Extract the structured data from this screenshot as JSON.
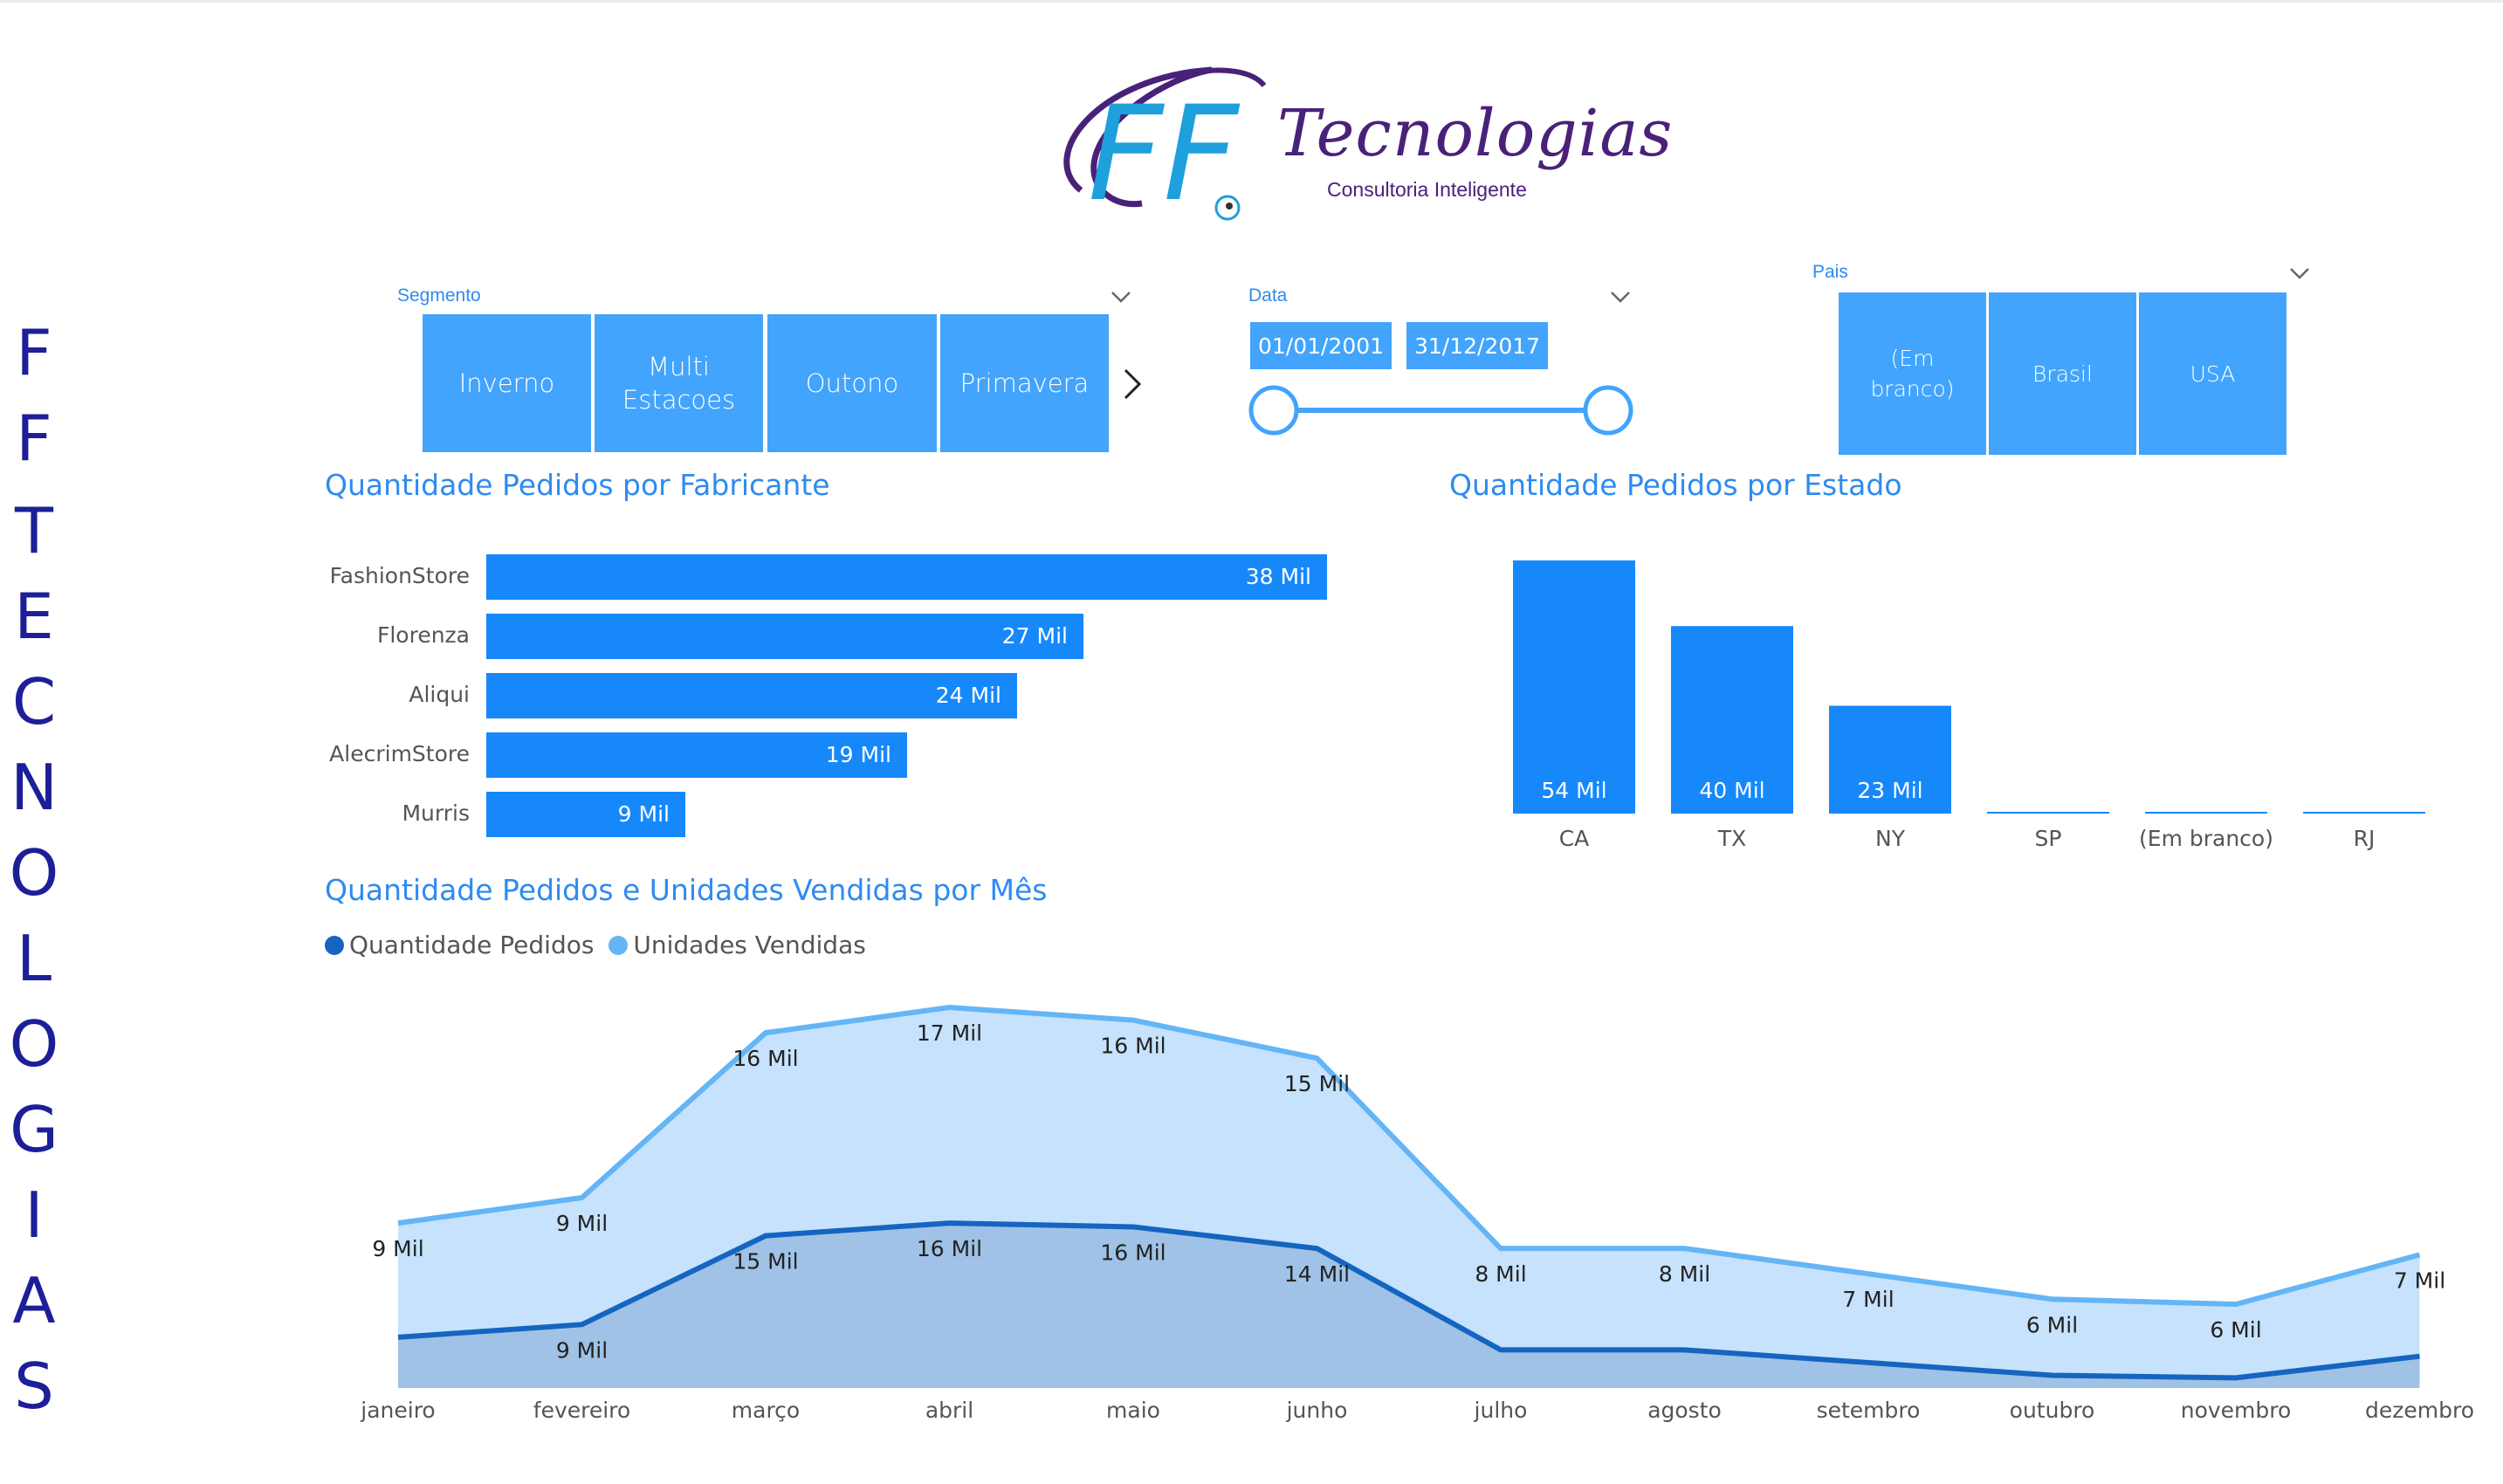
{
  "brand": {
    "vertical_text": [
      "F",
      "F",
      "",
      "T",
      "E",
      "C",
      "N",
      "O",
      "L",
      "O",
      "G",
      "I",
      "A",
      "S"
    ],
    "logo_mark": "FF",
    "logo_title": "Tecnologias",
    "logo_subtitle": "Consultoria Inteligente"
  },
  "slicers": {
    "segmento": {
      "label": "Segmento",
      "tiles": [
        "Inverno",
        "Multi Estacoes",
        "Outono",
        "Primavera"
      ]
    },
    "data": {
      "label": "Data",
      "start": "01/01/2001",
      "end": "31/12/2017",
      "range": [
        "01/01/2001",
        "31/12/2017"
      ]
    },
    "pais": {
      "label": "Pais",
      "tiles": [
        "(Em branco)",
        "Brasil",
        "USA"
      ]
    }
  },
  "colors": {
    "accent": "#2e8bf0",
    "bar": "#1688fa",
    "tile": "#42a4fc",
    "series_pedidos": "#1565c0",
    "series_unidades": "#64b5f6"
  },
  "chart_data": [
    {
      "type": "bar",
      "orientation": "horizontal",
      "title": "Quantidade Pedidos por Fabricante",
      "categories": [
        "FashionStore",
        "Florenza",
        "Aliqui",
        "AlecrimStore",
        "Murris"
      ],
      "values": [
        38000,
        27000,
        24000,
        19000,
        9000
      ],
      "data_labels": [
        "38 Mil",
        "27 Mil",
        "24 Mil",
        "19 Mil",
        "9 Mil"
      ]
    },
    {
      "type": "bar",
      "title": "Quantidade Pedidos por Estado",
      "categories": [
        "CA",
        "TX",
        "NY",
        "SP",
        "(Em branco)",
        "RJ"
      ],
      "values": [
        54000,
        40000,
        23000,
        0,
        0,
        0
      ],
      "data_labels": [
        "54 Mil",
        "40 Mil",
        "23 Mil",
        "",
        "",
        ""
      ]
    },
    {
      "type": "area",
      "title": "Quantidade Pedidos e Unidades Vendidas por Mês",
      "categories": [
        "janeiro",
        "fevereiro",
        "março",
        "abril",
        "maio",
        "junho",
        "julho",
        "agosto",
        "setembro",
        "outubro",
        "novembro",
        "dezembro"
      ],
      "series": [
        {
          "name": "Quantidade Pedidos",
          "values": [
            4000,
            5000,
            12000,
            13000,
            12700,
            11000,
            3000,
            3000,
            2000,
            1000,
            800,
            2500
          ],
          "data_labels": [
            "",
            "9 Mil",
            "15 Mil",
            "16 Mil",
            "16 Mil",
            "14 Mil",
            "",
            "",
            "",
            "",
            "",
            ""
          ]
        },
        {
          "name": "Unidades Vendidas",
          "values": [
            13000,
            15000,
            28000,
            30000,
            29000,
            26000,
            11000,
            11000,
            9000,
            7000,
            6600,
            10500
          ],
          "data_labels": [
            "9 Mil",
            "9 Mil",
            "16 Mil",
            "17 Mil",
            "16 Mil",
            "15 Mil",
            "8 Mil",
            "8 Mil",
            "7 Mil",
            "6 Mil",
            "6 Mil",
            "7 Mil"
          ]
        }
      ],
      "legend": "top-left",
      "ylim": [
        0,
        32000
      ]
    }
  ]
}
